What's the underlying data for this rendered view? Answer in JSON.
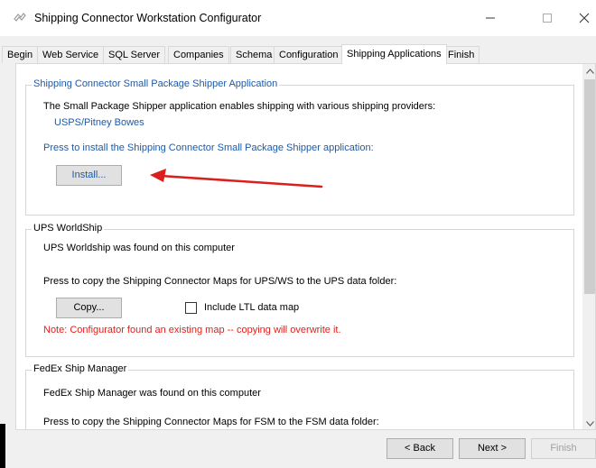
{
  "window": {
    "title": "Shipping Connector Workstation Configurator",
    "controls": {
      "minimize": "—",
      "maximize": "☐",
      "close": "✕"
    }
  },
  "tabs": [
    {
      "label": "Begin",
      "active": false
    },
    {
      "label": "Web Service",
      "active": false
    },
    {
      "label": "SQL Server",
      "active": false
    },
    {
      "label": "Companies",
      "active": false
    },
    {
      "label": "Schema",
      "active": false
    },
    {
      "label": "Configuration",
      "active": false
    },
    {
      "label": "Shipping Applications",
      "active": true
    },
    {
      "label": "Finish",
      "active": false
    }
  ],
  "small_package": {
    "legend": "Shipping Connector Small Package Shipper Application",
    "description": "The Small Package Shipper application enables shipping with various shipping providers:",
    "provider": "USPS/Pitney Bowes",
    "install_prompt": "Press to install the Shipping Connector Small Package Shipper application:",
    "install_button": "Install..."
  },
  "ups": {
    "legend": "UPS WorldShip",
    "found_text": "UPS Worldship was found on this computer",
    "copy_prompt": "Press to copy the Shipping Connector Maps for UPS/WS to the UPS data folder:",
    "copy_button": "Copy...",
    "ltl_checkbox_label": "Include LTL data map",
    "ltl_checked": false,
    "warning": "Note: Configurator found an existing map -- copying will overwrite it."
  },
  "fedex": {
    "legend": "FedEx Ship Manager",
    "found_text": "FedEx Ship Manager was found on this computer",
    "copy_prompt": "Press to copy the Shipping Connector Maps for FSM to the FSM data folder:"
  },
  "footer": {
    "back_button": "< Back",
    "next_button": "Next >",
    "finish_button": "Finish"
  },
  "colors": {
    "link_blue": "#1e5aa8",
    "warning_red": "#e0201b",
    "annotation_arrow": "#d9201c"
  }
}
